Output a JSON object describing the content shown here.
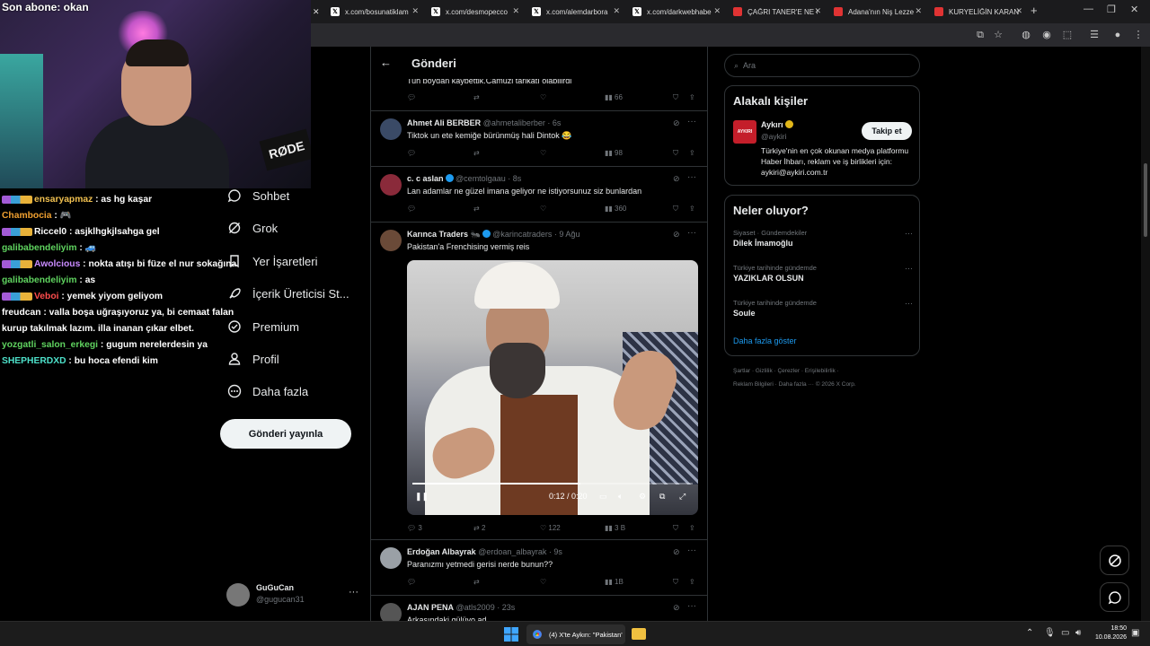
{
  "browser": {
    "tabs": [
      {
        "title": "x.com/bosunatiklam",
        "icon": "x"
      },
      {
        "title": "x.com/desmopecco",
        "icon": "x"
      },
      {
        "title": "x.com/alemdarbora",
        "icon": "x"
      },
      {
        "title": "x.com/darkwebhabe",
        "icon": "x"
      },
      {
        "title": "ÇAĞRI TANER'E NE O",
        "icon": "yt"
      },
      {
        "title": "Adana'nın Niş Lezze",
        "icon": "yt"
      },
      {
        "title": "KURYELİĞİN KARANL",
        "icon": "yt"
      }
    ],
    "new_tab": "+"
  },
  "stream": {
    "last_sub": "Son abone: okan",
    "mic_brand": "RØDE",
    "chat": [
      {
        "user": "ensaryapmaz",
        "color": "#f0c050",
        "msg": "as hg kaşar",
        "badges": true
      },
      {
        "user": "Chambocia",
        "color": "#f0a030",
        "msg": "🎮",
        "badges": false
      },
      {
        "user": "Riccel0",
        "color": "#ffffff",
        "msg": "asjklhgkjlsahga gel",
        "badges": true
      },
      {
        "user": "galibabendeliyim",
        "color": "#5fd35f",
        "msg": "🚙",
        "badges": false
      },
      {
        "user": "Awolcious",
        "color": "#c98bff",
        "msg": "nokta atışı bi füze el nur sokağına",
        "badges": true
      },
      {
        "user": "galibabendeliyim",
        "color": "#5fd35f",
        "msg": "as",
        "badges": false
      },
      {
        "user": "Veboi",
        "color": "#ff4d4d",
        "msg": "yemek yiyom geliyom",
        "badges": true
      },
      {
        "user": "freudcan",
        "color": "#ffffff",
        "msg": "valla boşa uğraşıyoruz ya, bi cemaat falan kurup takılmak lazım. illa inanan çıkar elbet.",
        "badges": false
      },
      {
        "user": "yozgatli_salon_erkegi",
        "color": "#5fd35f",
        "msg": "gugum nerelerdesin ya",
        "badges": false
      },
      {
        "user": "SHEPHERDXD",
        "color": "#4de0c9",
        "msg": "bu hoca efendi kim",
        "badges": false
      }
    ]
  },
  "nav": {
    "items": [
      {
        "label": "Sohbet",
        "icon": "chat-icon"
      },
      {
        "label": "Grok",
        "icon": "grok-icon"
      },
      {
        "label": "Yer İşaretleri",
        "icon": "bookmark-icon"
      },
      {
        "label": "İçerik Üreticisi St...",
        "icon": "rocket-icon"
      },
      {
        "label": "Premium",
        "icon": "premium-icon"
      },
      {
        "label": "Profil",
        "icon": "profile-icon"
      },
      {
        "label": "Daha fazla",
        "icon": "more-icon"
      }
    ],
    "post_button": "Gönderi yayınla",
    "account": {
      "name": "GuGuCan",
      "handle": "@gugucan31"
    }
  },
  "main": {
    "header_title": "Gönderi",
    "top_reply": {
      "text": "Tuh boydan kaybettik.Camuzi tarikatı olabilirdi",
      "views": "66"
    },
    "replies": [
      {
        "name": "Ahmet Ali BERBER",
        "handle": "@ahmetaliberber · 6s",
        "text": "Tiktok un ete kemiğe bürünmüş hali Dintok 😂",
        "views": "98",
        "verified": false,
        "avatar": "#3a4a66"
      },
      {
        "name": "c. c aslan",
        "handle": "@cemtolgaau · 8s",
        "text": "Lan adamlar ne güzel imana geliyor ne istiyorsunuz siz bunlardan",
        "views": "360",
        "verified": true,
        "avatar": "#8a2a3a"
      }
    ],
    "quote": {
      "name": "Karınca Traders 🐜",
      "handle": "@karincatraders · 9 Ağu",
      "text": "Pakistan'a Frenchising vermiş reis",
      "video_time": "0:12 / 0:20",
      "video_progress": 0.6,
      "replies": "3",
      "reposts": "2",
      "likes": "122",
      "views": "3 B"
    },
    "after": [
      {
        "name": "Erdoğan Albayrak",
        "handle": "@erdoan_albayrak · 9s",
        "text": "Paranızmı yetmedi gerisi nerde bunun??",
        "views": "1B",
        "avatar": "#9aa0a6"
      },
      {
        "name": "AJAN PENA",
        "handle": "@atls2009 · 23s",
        "text": "Arkasındaki gülüyo ad",
        "views": "",
        "avatar": "#555"
      }
    ]
  },
  "sidebar": {
    "search_placeholder": "Ara",
    "related_title": "Alakalı kişiler",
    "related": {
      "name": "Aykırı",
      "handle": "@aykiri",
      "bio": "Türkiye'nin en çok okunan medya platformu Haber İhbarı, reklam ve iş birlikleri için: aykiri@aykiri.com.tr",
      "follow_label": "Takip et",
      "logo_text": "AYKIRI"
    },
    "trends_title": "Neler oluyor?",
    "trends": [
      {
        "context": "Siyaset · Gündemdekiler",
        "name": "Dilek İmamoğlu"
      },
      {
        "context": "Türkiye tarihinde gündemde",
        "name": "YAZIKLAR OLSUN"
      },
      {
        "context": "Türkiye tarihinde gündemde",
        "name": "Soule"
      }
    ],
    "show_more": "Daha fazla göster",
    "footer_line1": "Şartlar · Gizlilik · Çerezler · Erişilebilirlik ·",
    "footer_line2": "Reklam Bilgileri · Daha fazla ··· © 2026 X Corp."
  },
  "taskbar": {
    "chrome_title": "(4) X'te Aykırı: \"Pakistan'",
    "time": "18:50",
    "date": "10.08.2026"
  }
}
